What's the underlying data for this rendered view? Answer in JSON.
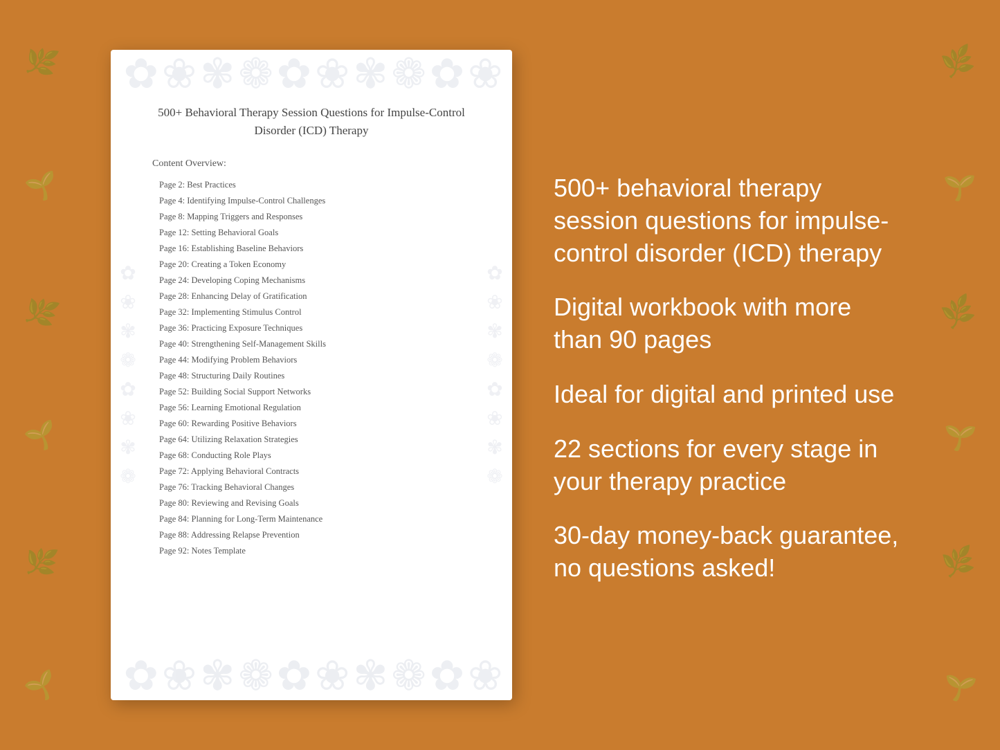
{
  "background_color": "#C97C2E",
  "document": {
    "title": "500+ Behavioral Therapy Session Questions for Impulse-Control Disorder (ICD) Therapy",
    "content_overview_heading": "Content Overview:",
    "toc_items": [
      {
        "page": "Page  2:",
        "label": "Best Practices"
      },
      {
        "page": "Page  4:",
        "label": "Identifying Impulse-Control Challenges"
      },
      {
        "page": "Page  8:",
        "label": "Mapping Triggers and Responses"
      },
      {
        "page": "Page 12:",
        "label": "Setting Behavioral Goals"
      },
      {
        "page": "Page 16:",
        "label": "Establishing Baseline Behaviors"
      },
      {
        "page": "Page 20:",
        "label": "Creating a Token Economy"
      },
      {
        "page": "Page 24:",
        "label": "Developing Coping Mechanisms"
      },
      {
        "page": "Page 28:",
        "label": "Enhancing Delay of Gratification"
      },
      {
        "page": "Page 32:",
        "label": "Implementing Stimulus Control"
      },
      {
        "page": "Page 36:",
        "label": "Practicing Exposure Techniques"
      },
      {
        "page": "Page 40:",
        "label": "Strengthening Self-Management Skills"
      },
      {
        "page": "Page 44:",
        "label": "Modifying Problem Behaviors"
      },
      {
        "page": "Page 48:",
        "label": "Structuring Daily Routines"
      },
      {
        "page": "Page 52:",
        "label": "Building Social Support Networks"
      },
      {
        "page": "Page 56:",
        "label": "Learning Emotional Regulation"
      },
      {
        "page": "Page 60:",
        "label": "Rewarding Positive Behaviors"
      },
      {
        "page": "Page 64:",
        "label": "Utilizing Relaxation Strategies"
      },
      {
        "page": "Page 68:",
        "label": "Conducting Role Plays"
      },
      {
        "page": "Page 72:",
        "label": "Applying Behavioral Contracts"
      },
      {
        "page": "Page 76:",
        "label": "Tracking Behavioral Changes"
      },
      {
        "page": "Page 80:",
        "label": "Reviewing and Revising Goals"
      },
      {
        "page": "Page 84:",
        "label": "Planning for Long-Term Maintenance"
      },
      {
        "page": "Page 88:",
        "label": "Addressing Relapse Prevention"
      },
      {
        "page": "Page 92:",
        "label": "Notes Template"
      }
    ]
  },
  "features": [
    "500+ behavioral therapy session questions for impulse-control disorder (ICD) therapy",
    "Digital workbook with more than 90 pages",
    "Ideal for digital and printed use",
    "22 sections for every stage in your therapy practice",
    "30-day money-back guarantee, no questions asked!"
  ],
  "floral_glyphs": [
    "❧",
    "✿",
    "❀",
    "❁",
    "✾",
    "❃",
    "✽",
    "❋",
    "✤"
  ]
}
